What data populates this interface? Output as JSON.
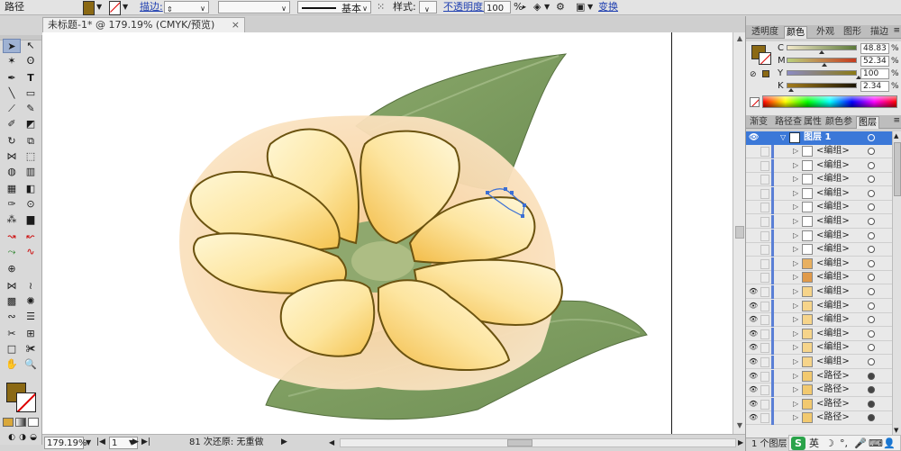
{
  "control_bar": {
    "object_type": "路径",
    "stroke_label": "描边:",
    "stroke_style": "基本",
    "style_label": "样式:",
    "opacity_label": "不透明度:",
    "opacity_value": "100",
    "opacity_unit": "%",
    "transform_label": "变换",
    "fill_color": "#8b6914"
  },
  "document": {
    "tab_title": "未标题-1* @ 179.19% (CMYK/预览)",
    "tab_close": "×"
  },
  "status_bar": {
    "zoom": "179.19%",
    "page": "1",
    "undo_info": "81 次还原: 无重做"
  },
  "tools": {
    "fill_color": "#8b6914"
  },
  "color_panel": {
    "tabs": [
      "透明度",
      "颜色",
      "外观",
      "图形",
      "描边"
    ],
    "active_tab": "颜色",
    "channels": [
      {
        "label": "C",
        "value": "48.83",
        "gradient": "#e8e8e8,#00a0e0"
      },
      {
        "label": "M",
        "value": "52.34",
        "gradient": "#e8e8e8,#e0007a"
      },
      {
        "label": "Y",
        "value": "100",
        "gradient": "#e8e8e8,#f2e000"
      },
      {
        "label": "K",
        "value": "2.34",
        "gradient": "#e8e8e8,#111111"
      }
    ],
    "unit": "%"
  },
  "layers_panel": {
    "tabs": [
      "渐变",
      "路径查",
      "属性",
      "颜色参",
      "图层"
    ],
    "active_tab": "图层",
    "layer_name": "图层 1",
    "items": [
      {
        "name": "<编组>",
        "eye": false,
        "thumb": "#ffffff",
        "target": "hollow"
      },
      {
        "name": "<编组>",
        "eye": false,
        "thumb": "#ffffff",
        "target": "hollow"
      },
      {
        "name": "<编组>",
        "eye": false,
        "thumb": "#ffffff",
        "target": "hollow"
      },
      {
        "name": "<编组>",
        "eye": false,
        "thumb": "#ffffff",
        "target": "hollow"
      },
      {
        "name": "<编组>",
        "eye": false,
        "thumb": "#ffffff",
        "target": "hollow"
      },
      {
        "name": "<编组>",
        "eye": false,
        "thumb": "#ffffff",
        "target": "hollow"
      },
      {
        "name": "<编组>",
        "eye": false,
        "thumb": "#ffffff",
        "target": "hollow"
      },
      {
        "name": "<编组>",
        "eye": false,
        "thumb": "#ffffff",
        "target": "hollow"
      },
      {
        "name": "<编组>",
        "eye": false,
        "thumb": "#e8b060",
        "target": "hollow"
      },
      {
        "name": "<编组>",
        "eye": false,
        "thumb": "#e09a4a",
        "target": "hollow"
      },
      {
        "name": "<编组>",
        "eye": true,
        "thumb": "#f6d48a",
        "target": "hollow"
      },
      {
        "name": "<编组>",
        "eye": true,
        "thumb": "#f6d48a",
        "target": "hollow"
      },
      {
        "name": "<编组>",
        "eye": true,
        "thumb": "#f6d48a",
        "target": "hollow"
      },
      {
        "name": "<编组>",
        "eye": true,
        "thumb": "#f6d48a",
        "target": "hollow"
      },
      {
        "name": "<编组>",
        "eye": true,
        "thumb": "#f6d48a",
        "target": "hollow"
      },
      {
        "name": "<编组>",
        "eye": true,
        "thumb": "#f6d48a",
        "target": "hollow"
      },
      {
        "name": "<路径>",
        "eye": true,
        "thumb": "#f2c96f",
        "target": "filled"
      },
      {
        "name": "<路径>",
        "eye": true,
        "thumb": "#f2c96f",
        "target": "filled"
      },
      {
        "name": "<路径>",
        "eye": true,
        "thumb": "#f2c96f",
        "target": "filled"
      },
      {
        "name": "<路径>",
        "eye": true,
        "thumb": "#f2c96f",
        "target": "filled"
      }
    ],
    "footer": "1 个图层"
  },
  "ime_bar": {
    "logo": "S",
    "lang": "英"
  }
}
